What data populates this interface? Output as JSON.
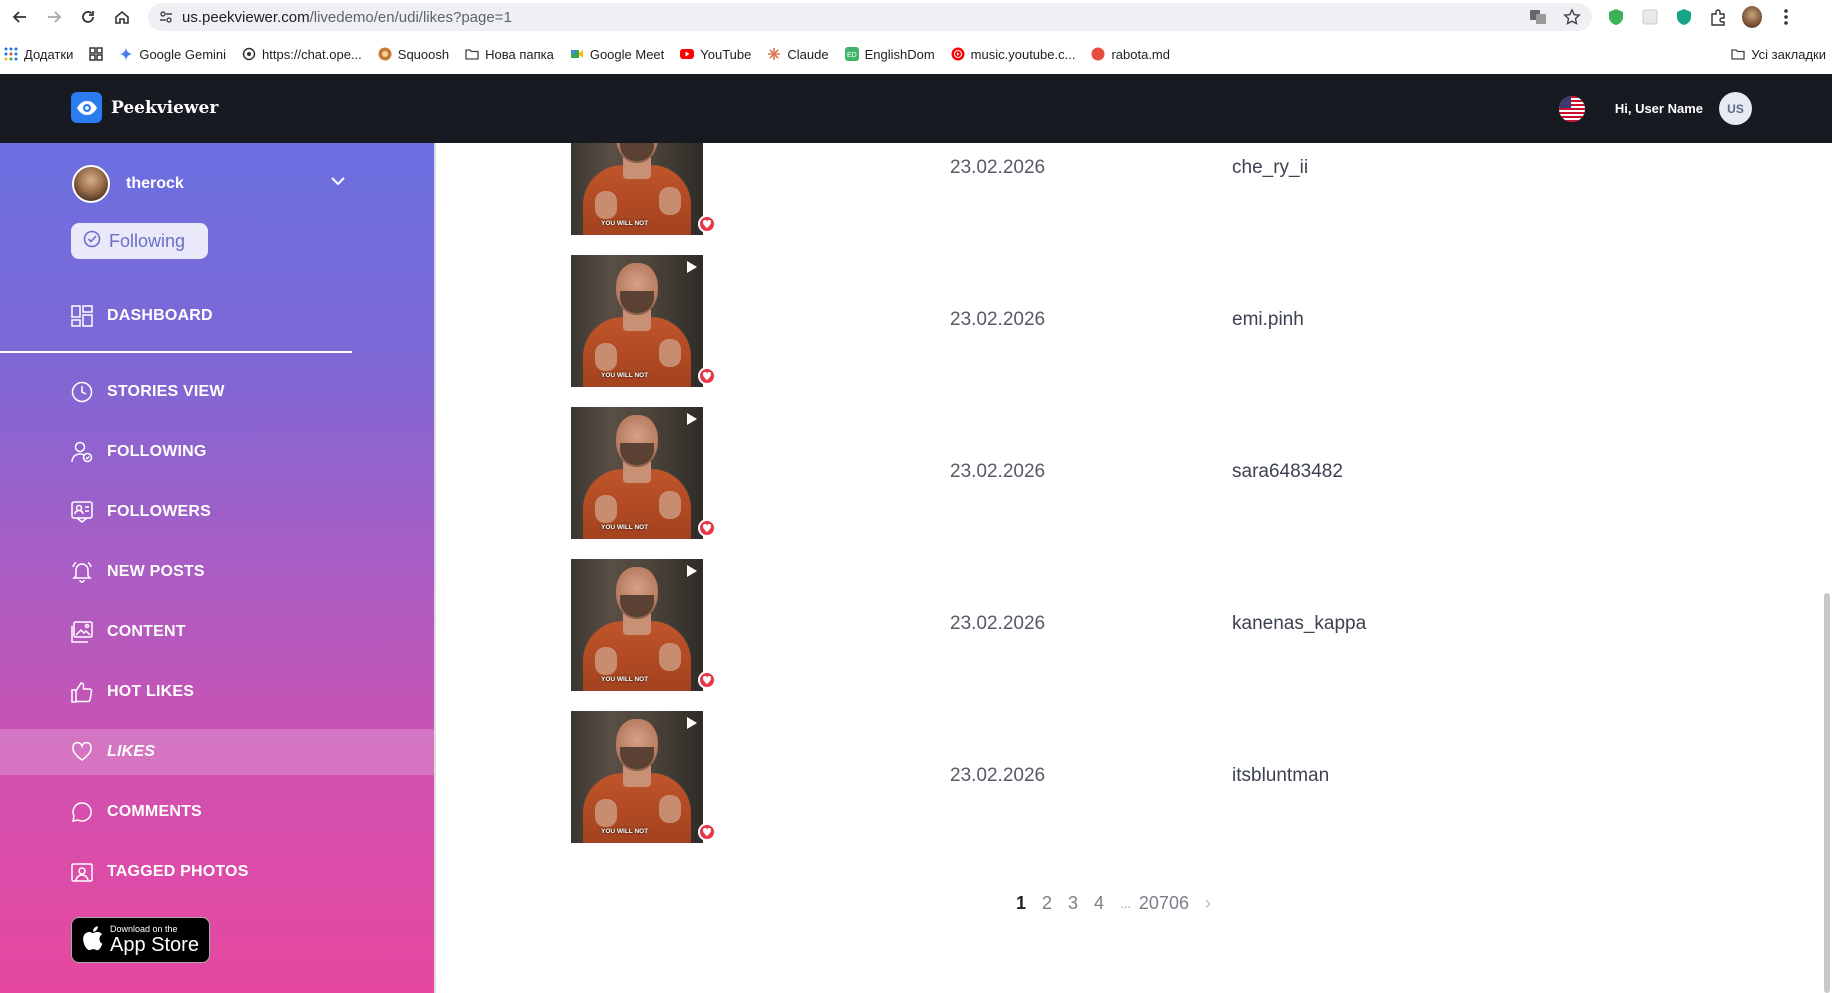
{
  "browser": {
    "url_domain": "us.peekviewer.com",
    "url_path": "/livedemo/en/udi/likes?page=1",
    "bookmarks": [
      {
        "label": "Додатки",
        "icon": "apps-grid-icon"
      },
      {
        "label": "",
        "icon": "grid-icon"
      },
      {
        "label": "Google Gemini",
        "icon": "gemini-icon"
      },
      {
        "label": "https://chat.ope...",
        "icon": "openai-icon"
      },
      {
        "label": "Squoosh",
        "icon": "squoosh-icon"
      },
      {
        "label": "Нова папка",
        "icon": "folder-icon"
      },
      {
        "label": "Google Meet",
        "icon": "meet-icon"
      },
      {
        "label": "YouTube",
        "icon": "youtube-icon"
      },
      {
        "label": "Claude",
        "icon": "claude-icon"
      },
      {
        "label": "EnglishDom",
        "icon": "englishdom-icon"
      },
      {
        "label": "music.youtube.c...",
        "icon": "youtube-music-icon"
      },
      {
        "label": "rabota.md",
        "icon": "rabota-icon"
      }
    ],
    "all_bookmarks_label": "Усі закладки"
  },
  "header": {
    "brand": "Peekviewer",
    "greeting": "Hi,  User Name",
    "user_initials": "US"
  },
  "sidebar": {
    "profile_name": "therock",
    "following_label": "Following",
    "dashboard_label": "DASHBOARD",
    "items": [
      {
        "label": "STORIES VIEW",
        "icon": "clock-icon"
      },
      {
        "label": "FOLLOWING",
        "icon": "user-follow-icon"
      },
      {
        "label": "FOLLOWERS",
        "icon": "followers-icon"
      },
      {
        "label": "NEW POSTS",
        "icon": "bell-icon"
      },
      {
        "label": "CONTENT",
        "icon": "image-icon"
      },
      {
        "label": "HOT LIKES",
        "icon": "thumbs-up-icon"
      },
      {
        "label": "LIKES",
        "icon": "heart-icon",
        "active": true
      },
      {
        "label": "COMMENTS",
        "icon": "comment-icon"
      },
      {
        "label": "TAGGED PHOTOS",
        "icon": "tagged-photo-icon"
      }
    ],
    "appstore_small": "Download on the",
    "appstore_big": "App Store"
  },
  "likes": [
    {
      "date": "23.02.2026",
      "username": "che_ry_ii",
      "caption": "YOU WILL NOT"
    },
    {
      "date": "23.02.2026",
      "username": "emi.pinh",
      "caption": "YOU WILL NOT"
    },
    {
      "date": "23.02.2026",
      "username": "sara6483482",
      "caption": "YOU WILL NOT"
    },
    {
      "date": "23.02.2026",
      "username": "kanenas_kappa",
      "caption": "YOU WILL NOT"
    },
    {
      "date": "23.02.2026",
      "username": "itsbluntman",
      "caption": "YOU WILL NOT"
    }
  ],
  "pagination": {
    "pages": [
      "1",
      "2",
      "3",
      "4"
    ],
    "current": "1",
    "ellipsis": "...",
    "last": "20706",
    "next": "›"
  },
  "colors": {
    "header_bg": "#171a21",
    "accent_blue": "#2b7cf0",
    "heart_red": "#e8334a",
    "sidebar_top": "#6b6fe0",
    "sidebar_bottom": "#e6489f"
  }
}
